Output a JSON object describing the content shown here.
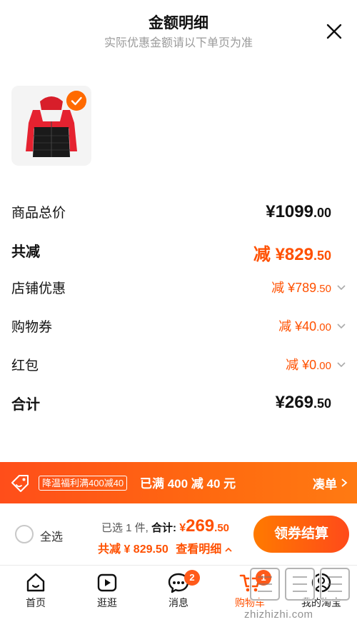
{
  "header": {
    "title": "金额明细",
    "subtitle": "实际优惠金额请以下单页为准"
  },
  "product": {
    "image": "red-black-down-jacket",
    "selected": true
  },
  "rows": [
    {
      "label": "商品总价",
      "prefix": "",
      "main": "¥1099",
      "cents": ".00",
      "style": "black",
      "arrow": false
    },
    {
      "label": "共减",
      "prefix": "减 ",
      "main": "¥829",
      "cents": ".50",
      "style": "orange",
      "arrow": false
    },
    {
      "label": "店铺优惠",
      "prefix": "减 ",
      "main": "¥789",
      "cents": ".50",
      "style": "orange-light",
      "arrow": true
    },
    {
      "label": "购物券",
      "prefix": "减 ",
      "main": "¥40",
      "cents": ".00",
      "style": "orange-light",
      "arrow": true
    },
    {
      "label": "红包",
      "prefix": "减 ",
      "main": "¥0",
      "cents": ".00",
      "style": "orange-light",
      "arrow": true
    },
    {
      "label": "合计",
      "prefix": "",
      "main": "¥269",
      "cents": ".50",
      "style": "black",
      "arrow": false
    }
  ],
  "promo": {
    "tag": "降温福利满400减40",
    "text": "已满 400 减 40 元",
    "action": "凑单"
  },
  "checkout": {
    "select_all": "全选",
    "selected_text": "已选 1 件,",
    "total_label": "合计:",
    "yen": "¥",
    "total_main": "269",
    "total_cents": ".50",
    "discount_text": "共减 ¥ 829.50",
    "detail_link": "查看明细",
    "pay_button": "领券结算"
  },
  "tabbar": {
    "items": [
      {
        "label": "首页",
        "icon": "home-icon"
      },
      {
        "label": "逛逛",
        "icon": "play-icon"
      },
      {
        "label": "消息",
        "icon": "chat-icon",
        "badge": "2"
      },
      {
        "label": "购物车",
        "icon": "cart-icon",
        "badge": "1"
      },
      {
        "label": "我的淘宝",
        "icon": "user-icon"
      }
    ]
  },
  "watermark": {
    "text": "值 值 值",
    "url": "zhizhizhi.com"
  },
  "colors": {
    "accent": "#ff5000",
    "promo_bg": "#ff5a14"
  }
}
